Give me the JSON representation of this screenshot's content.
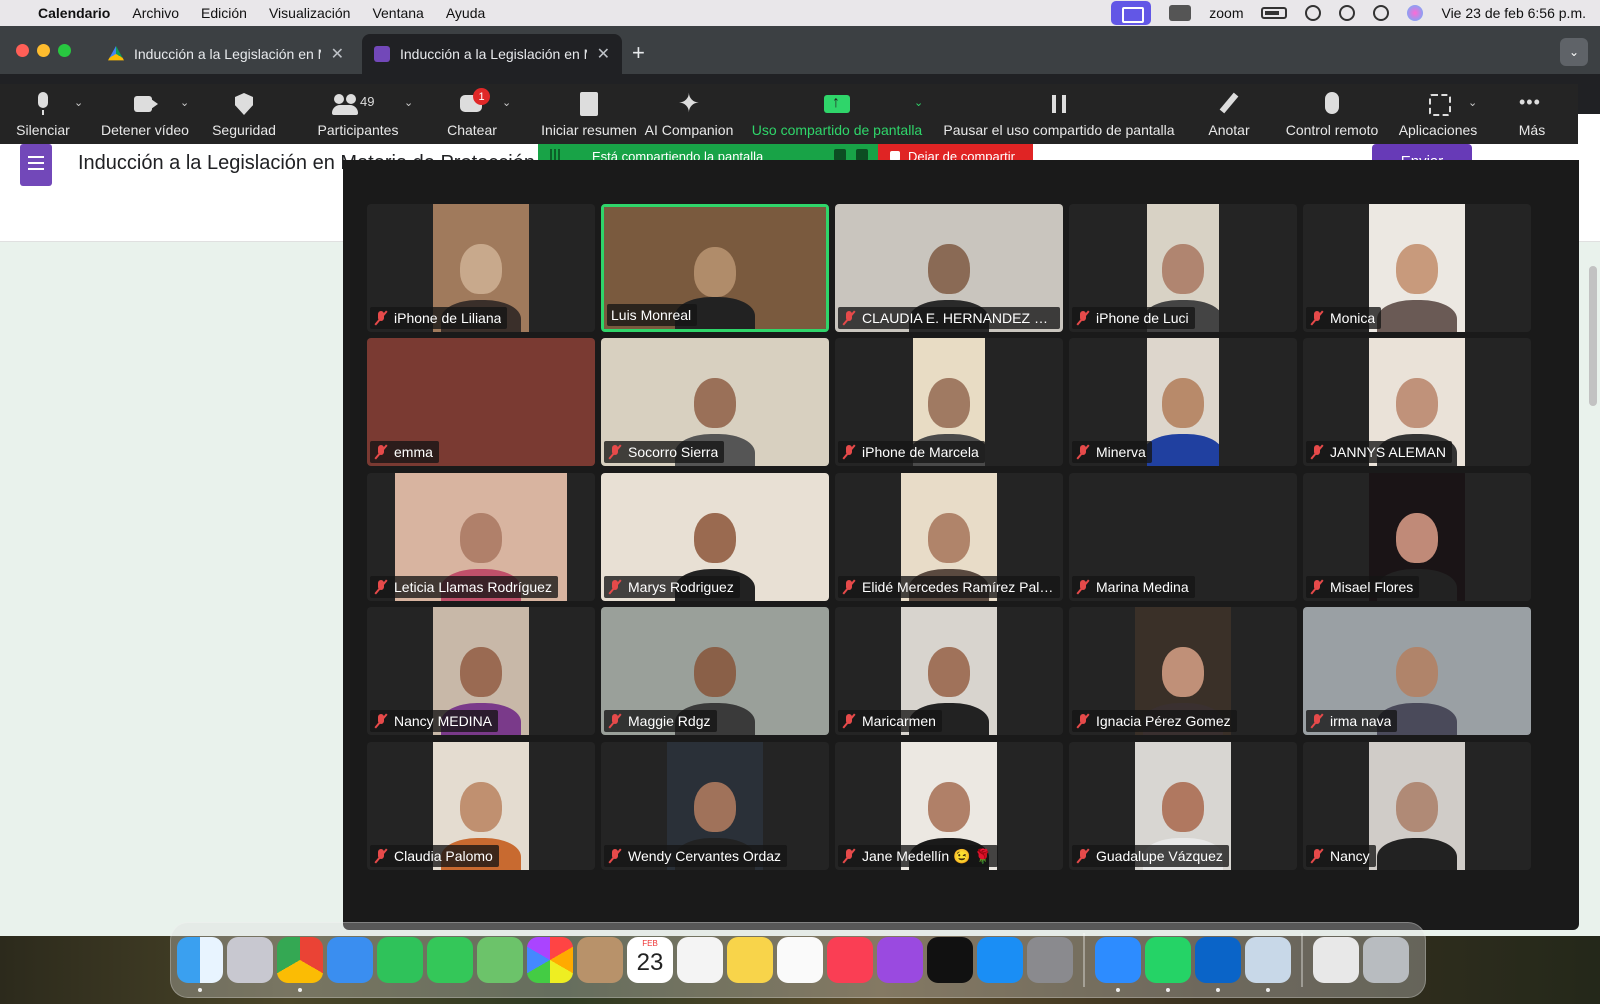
{
  "menubar": {
    "app": "Calendario",
    "items": [
      "Archivo",
      "Edición",
      "Visualización",
      "Ventana",
      "Ayuda"
    ],
    "zoom_label": "zoom",
    "clock": "Vie 23 de feb  6:56 p.m."
  },
  "browser": {
    "tabs": [
      {
        "title": "Inducción a la Legislación en Materia de Protección",
        "icon": "google-drive-icon"
      },
      {
        "title": "Inducción a la Legislación en Materia de Protección",
        "icon": "google-forms-icon"
      }
    ],
    "new_tab": "+",
    "tab_menu": "⌄"
  },
  "forms": {
    "title": "Inducción a la Legislación en Materia de Protección",
    "send_label": "Enviar",
    "accent": "#673ab7",
    "background": "#e9f2ec"
  },
  "zoom_toolbar": {
    "mute": "Silenciar",
    "stop_video": "Detener vídeo",
    "security": "Seguridad",
    "participants": "Participantes",
    "participant_count": "49",
    "chat": "Chatear",
    "chat_badge": "1",
    "summary": "Iniciar resumen",
    "companion": "AI Companion",
    "share": "Uso compartido de pantalla",
    "pause_share": "Pausar el uso compartido de pantalla",
    "annotate": "Anotar",
    "remote_control": "Control remoto",
    "apps": "Aplicaciones",
    "more": "Más",
    "share_color": "#2fd56a"
  },
  "share_banner": {
    "status": "Está compartiendo la pantalla",
    "stop": "Dejar de compartir",
    "green": "#18a347",
    "red": "#e02424"
  },
  "participants": [
    {
      "name": "iPhone de Liliana",
      "muted": true
    },
    {
      "name": "Luis Monreal",
      "muted": false,
      "speaking": true
    },
    {
      "name": "CLAUDIA E. HERNANDEZ MO...",
      "muted": true
    },
    {
      "name": "iPhone de Luci",
      "muted": true
    },
    {
      "name": "Monica",
      "muted": true
    },
    {
      "name": "emma",
      "muted": true
    },
    {
      "name": "Socorro Sierra",
      "muted": true
    },
    {
      "name": "iPhone de Marcela",
      "muted": true
    },
    {
      "name": "Minerva",
      "muted": true
    },
    {
      "name": "JANNYS ALEMAN",
      "muted": true
    },
    {
      "name": "Leticia Llamas Rodríguez",
      "muted": true
    },
    {
      "name": "Marys Rodriguez",
      "muted": true
    },
    {
      "name": "Elidé Mercedes Ramírez Palo...",
      "muted": true
    },
    {
      "name": "Marina Medina",
      "muted": true
    },
    {
      "name": "Misael Flores",
      "muted": true
    },
    {
      "name": "Nancy MEDINA",
      "muted": true
    },
    {
      "name": "Maggie Rdgz",
      "muted": true
    },
    {
      "name": "Maricarmen",
      "muted": true
    },
    {
      "name": "Ignacia Pérez Gomez",
      "muted": true
    },
    {
      "name": "irma nava",
      "muted": true
    },
    {
      "name": "Claudia Palomo",
      "muted": true
    },
    {
      "name": "Wendy Cervantes Ordaz",
      "muted": true
    },
    {
      "name": "Jane Medellín 😉 🌹",
      "muted": true
    },
    {
      "name": "Guadalupe Vázquez",
      "muted": true
    },
    {
      "name": "Nancy",
      "muted": true
    }
  ],
  "dock": {
    "calendar_month": "FEB",
    "calendar_day": "23",
    "apps": [
      "finder-icon",
      "launchpad-icon",
      "chrome-icon",
      "mail-icon",
      "facetime-icon",
      "messages-icon",
      "maps-icon",
      "photos-icon",
      "contacts-icon",
      "calendar-icon",
      "reminders-icon",
      "notes-icon",
      "freeform-icon",
      "music-icon",
      "podcasts-icon",
      "tv-icon",
      "app-store-icon",
      "system-settings-icon",
      "zoom-icon",
      "whatsapp-icon",
      "outlook-icon",
      "preview-icon",
      "documents-icon",
      "trash-icon"
    ]
  }
}
